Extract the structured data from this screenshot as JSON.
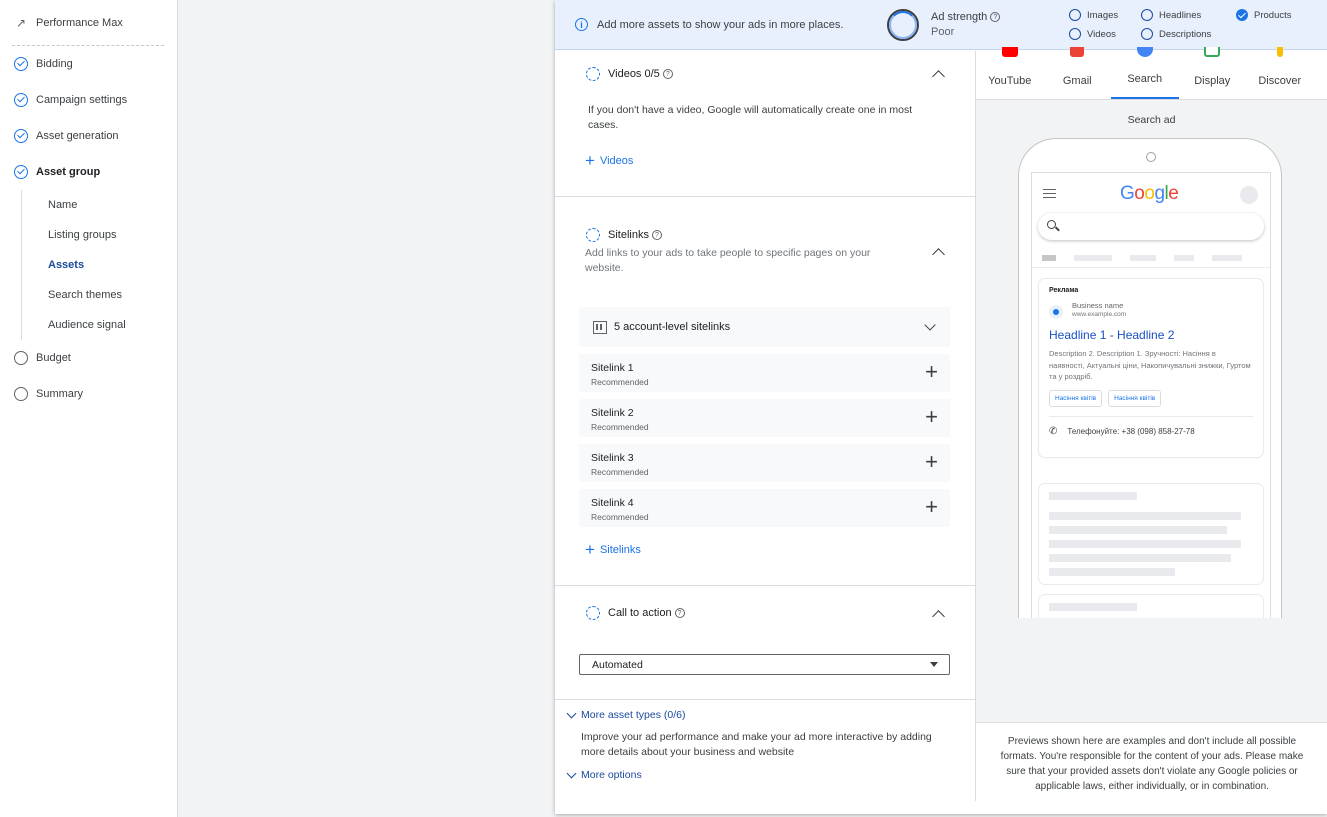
{
  "sidebar": {
    "top_label": "Performance Max",
    "items": [
      {
        "label": "Bidding"
      },
      {
        "label": "Campaign settings"
      },
      {
        "label": "Asset generation"
      },
      {
        "label": "Asset group"
      }
    ],
    "sub_items": [
      {
        "label": "Name"
      },
      {
        "label": "Listing groups"
      },
      {
        "label": "Assets"
      },
      {
        "label": "Search themes"
      },
      {
        "label": "Audience signal"
      }
    ],
    "bottom_items": [
      {
        "label": "Budget"
      },
      {
        "label": "Summary"
      }
    ]
  },
  "banner": {
    "info_text": "Add more assets to show your ads in more places.",
    "ad_strength_label": "Ad strength",
    "ad_strength_value": "Poor",
    "checklist": [
      {
        "label": "Images",
        "done": false
      },
      {
        "label": "Headlines",
        "done": false
      },
      {
        "label": "Products",
        "done": true
      },
      {
        "label": "Videos",
        "done": false
      },
      {
        "label": "Descriptions",
        "done": false
      }
    ]
  },
  "videos": {
    "title": "Videos 0/5",
    "description": "If you don't have a video, Google will automatically create one in most cases.",
    "add_label": "Videos"
  },
  "sitelinks": {
    "title": "Sitelinks",
    "description": "Add links to your ads to take people to specific pages on your website.",
    "account_level": "5 account-level sitelinks",
    "items": [
      {
        "name": "Sitelink 1",
        "tag": "Recommended"
      },
      {
        "name": "Sitelink 2",
        "tag": "Recommended"
      },
      {
        "name": "Sitelink 3",
        "tag": "Recommended"
      },
      {
        "name": "Sitelink 4",
        "tag": "Recommended"
      }
    ],
    "add_label": "Sitelinks"
  },
  "cta": {
    "title": "Call to action",
    "selected": "Automated"
  },
  "more": {
    "asset_types": "More asset types (0/6)",
    "description": "Improve your ad performance and make your ad more interactive by adding more details about your business and website",
    "options": "More options"
  },
  "preview": {
    "tabs": [
      {
        "label": "YouTube",
        "color": "#ff0000"
      },
      {
        "label": "Gmail",
        "color": "#ea4335"
      },
      {
        "label": "Search",
        "color": "#4285f4"
      },
      {
        "label": "Display",
        "color": "#34a853"
      },
      {
        "label": "Discover",
        "color": "#fbbc04"
      }
    ],
    "active_tab": "Search",
    "title": "Search ad",
    "ad": {
      "label": "Реклама",
      "business": "Business name",
      "url": "www.example.com",
      "headline": "Headline 1 - Headline 2",
      "description": "Description 2. Description 1. Зручності: Насіння в наявності, Актуальні ціни, Накопичувальні знижки, Гуртом та у роздріб.",
      "chips": [
        "Насіння квітів",
        "Насіння квітів"
      ],
      "call": "Телефонуйте: +38 (098) 858-27-78"
    },
    "disclaimer": "Previews shown here are examples and don't include all possible formats. You're responsible for the content of your ads. Please make sure that your provided assets don't violate any Google policies or applicable laws, either individually, or in combination."
  }
}
